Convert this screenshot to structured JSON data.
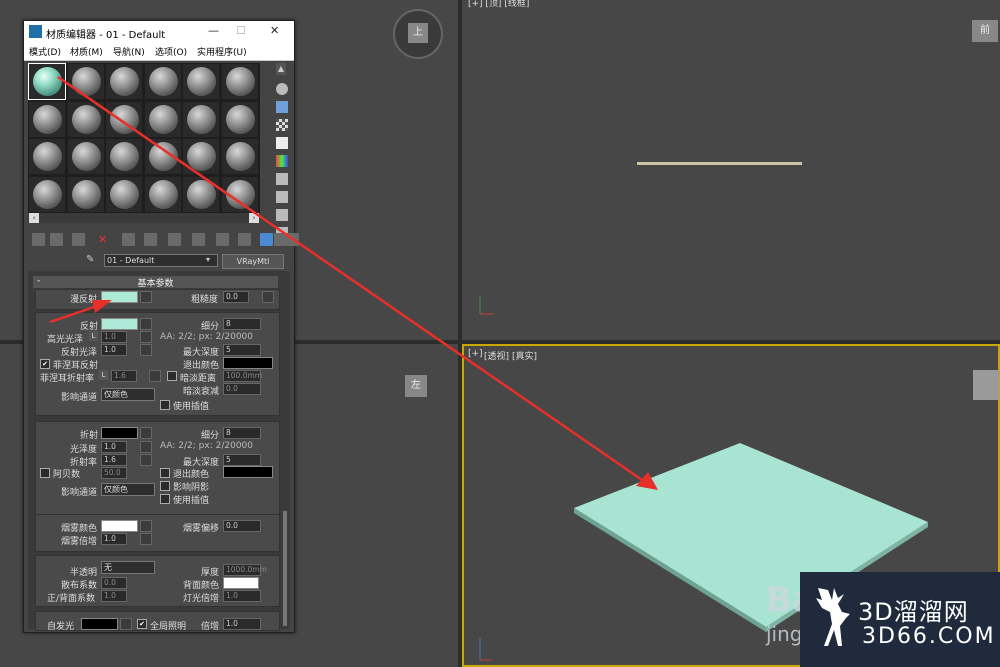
{
  "window": {
    "title": "材质编辑器 - 01 - Default",
    "menu": [
      "模式(D)",
      "材质(M)",
      "导航(N)",
      "选项(O)",
      "实用程序(U)"
    ]
  },
  "material": {
    "name": "01 - Default",
    "type": "VRayMtl",
    "rollout_title": "基本参数"
  },
  "diffuse": {
    "label": "漫反射",
    "color": "#aee8d6",
    "roughness_label": "粗糙度",
    "roughness": "0.0"
  },
  "reflection": {
    "label": "反射",
    "color": "#aee8d6",
    "subdivs_label": "细分",
    "subdivs": "8",
    "hilight_label": "高光光泽",
    "hilight_lock": "L",
    "hilight": "1.0",
    "aa_text": "AA: 2/2; px: 2/20000",
    "gloss_label": "反射光泽",
    "gloss": "1.0",
    "maxdepth_label": "最大深度",
    "maxdepth": "5",
    "fresnel_label": "菲涅耳反射",
    "exit_color_label": "退出颜色",
    "fresnel_ior_label": "菲涅耳折射率",
    "fresnel_lock": "L",
    "fresnel_ior": "1.6",
    "dim_dist_label": "暗淡距离",
    "dim_dist": "100.0mm",
    "dim_falloff_label": "暗淡衰减",
    "dim_falloff": "0.0",
    "affect_label": "影响通道",
    "affect": "仅颜色",
    "interp_label": "使用插值"
  },
  "refraction": {
    "label": "折射",
    "color": "#000000",
    "subdivs_label": "细分",
    "subdivs": "8",
    "aa_text": "AA: 2/2; px: 2/20000",
    "gloss_label": "光泽度",
    "gloss": "1.0",
    "ior_label": "折射率",
    "ior": "1.6",
    "maxdepth_label": "最大深度",
    "maxdepth": "5",
    "abbe_label": "阿贝数",
    "abbe": "50.0",
    "exit_color_label": "退出颜色",
    "affect_label": "影响通道",
    "affect": "仅颜色",
    "shadows_label": "影响阴影",
    "interp_label": "使用插值"
  },
  "fog": {
    "color_label": "烟雾颜色",
    "color": "#ffffff",
    "mult_label": "烟雾倍增",
    "mult": "1.0",
    "bias_label": "烟雾偏移",
    "bias": "0.0"
  },
  "translucency": {
    "label": "半透明",
    "type": "无",
    "thickness_label": "厚度",
    "thickness": "1000.0mm",
    "scatter_label": "散布系数",
    "scatter": "0.0",
    "back_color_label": "背面颜色",
    "fwd_label": "正/背面系数",
    "fwd": "1.0",
    "light_mult_label": "灯光倍增",
    "light_mult": "1.0"
  },
  "selfillum": {
    "label": "自发光",
    "gi_label": "全局照明",
    "mult_label": "倍增",
    "mult": "1.0"
  },
  "viewports": {
    "top_label": "[+] [顶] [线框]",
    "persp_label_1": "[+]",
    "persp_label_2": "[透视]",
    "persp_label_3": "[真实]",
    "cube_top": "上",
    "cube_back": "前",
    "cube_left": "左"
  },
  "watermark": {
    "brand": "3D溜溜网",
    "url": "3D66.COM",
    "jing": "jing",
    "ba": "Ba"
  },
  "colors": {
    "arrow": "#e8302a",
    "plane": "#a9e3d2",
    "viewport_active": "#c8a800"
  }
}
